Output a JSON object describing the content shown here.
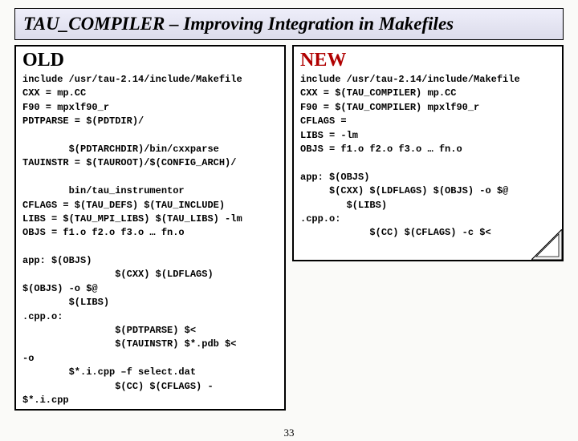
{
  "title": "TAU_COMPILER – Improving Integration in Makefiles",
  "page_number": "33",
  "old": {
    "heading": "OLD",
    "code": "include /usr/tau-2.14/include/Makefile\nCXX = mp.CC\nF90 = mpxlf90_r\nPDTPARSE = $(PDTDIR)/\n\n        $(PDTARCHDIR)/bin/cxxparse\nTAUINSTR = $(TAUROOT)/$(CONFIG_ARCH)/\n\n        bin/tau_instrumentor\nCFLAGS = $(TAU_DEFS) $(TAU_INCLUDE)\nLIBS = $(TAU_MPI_LIBS) $(TAU_LIBS) -lm\nOBJS = f1.o f2.o f3.o … fn.o\n\napp: $(OBJS)\n                $(CXX) $(LDFLAGS)\n$(OBJS) -o $@\n        $(LIBS)\n.cpp.o:\n                $(PDTPARSE) $<\n                $(TAUINSTR) $*.pdb $<\n-o\n        $*.i.cpp –f select.dat\n                $(CC) $(CFLAGS) -\n$*.i.cpp"
  },
  "new": {
    "heading": "NEW",
    "line1": "include /usr/tau-2.14/include/Makefile",
    "line2a": "CXX = ",
    "line2b": "$(TAU_COMPILER)",
    "line2c": " mp.CC",
    "line3a": "F90 = ",
    "line3b": "$(TAU_COMPILER)",
    "line3c": " mpxlf90_r",
    "line4": "CFLAGS =",
    "line5": "LIBS = -lm",
    "line6a": "OBJS = ",
    "line6b": "f1.o f2.o f3.o … fn.o",
    "block2": "app: $(OBJS)\n     $(CXX) $(LDFLAGS) $(OBJS) -o $@\n        $(LIBS)\n.cpp.o:\n            $(CC) $(CFLAGS) -c $<"
  }
}
